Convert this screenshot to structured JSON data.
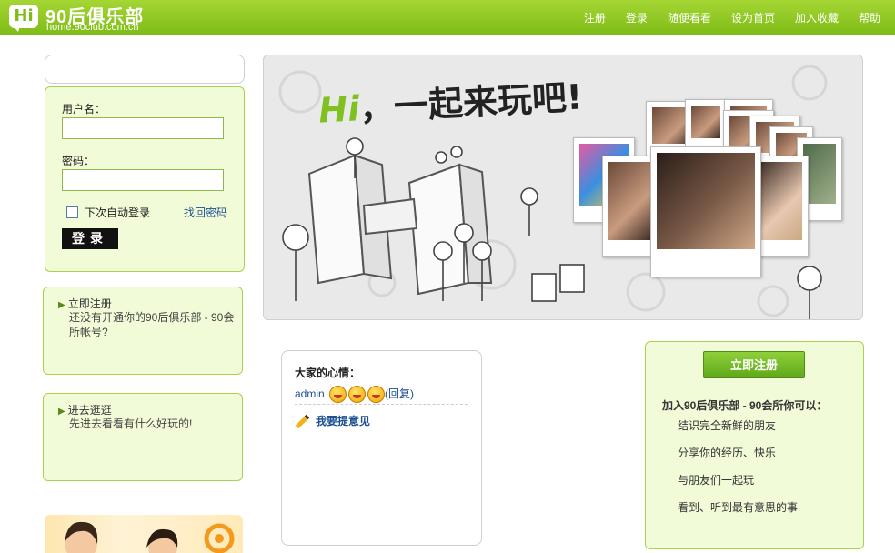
{
  "header": {
    "logo_badge": "Hi",
    "logo_text": "90后俱乐部",
    "logo_domain": "home.90club.com.cn",
    "nav": [
      "注册",
      "登录",
      "随便看看",
      "设为首页",
      "加入收藏",
      "帮助"
    ]
  },
  "login": {
    "username_label": "用户名：",
    "username_value": "",
    "password_label": "密码：",
    "password_value": "",
    "remember_label": "下次自动登录",
    "forgot_link": "找回密码",
    "submit_label": "登录"
  },
  "side_boxes": [
    {
      "title": "立即注册",
      "text": "还没有开通你的90后俱乐部 - 90会所帐号?"
    },
    {
      "title": "进去逛逛",
      "text": "先进去看看有什么好玩的!"
    }
  ],
  "banner": {
    "hi": "Hi",
    "title": "，一起来玩吧!"
  },
  "mood": {
    "title": "大家的心情：",
    "user": "admin",
    "reply": "(回复)",
    "suggest": "我要提意见"
  },
  "register": {
    "button": "立即注册",
    "title": "加入90后俱乐部 - 90会所你可以：",
    "items": [
      "结识完全新鲜的朋友",
      "分享你的经历、快乐",
      "与朋友们一起玩",
      "看到、听到最有意思的事"
    ]
  },
  "colors": {
    "brand_green": "#7fbc17",
    "panel_fill": "#f2fbd8",
    "link_blue": "#1d4f91"
  }
}
